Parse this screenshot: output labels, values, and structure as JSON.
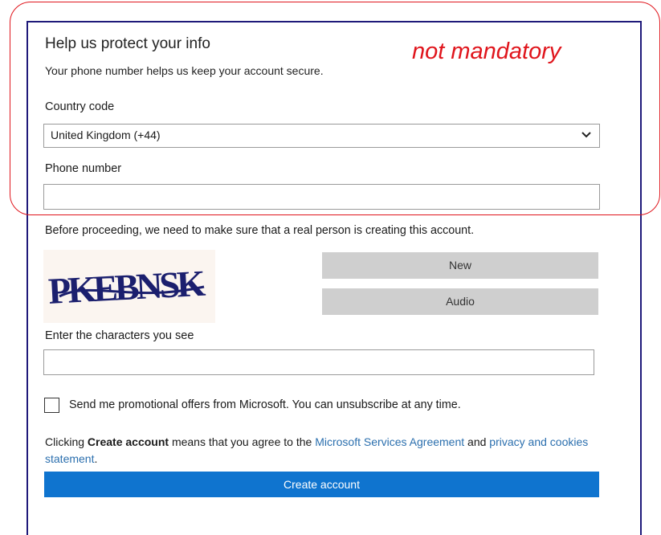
{
  "header": {
    "title": "Help us protect your info",
    "subtitle": "Your phone number helps us keep your account secure."
  },
  "annotation": {
    "text": "not mandatory",
    "color": "#e0151c"
  },
  "country": {
    "label": "Country code",
    "selected": "United Kingdom (+44)"
  },
  "phone": {
    "label": "Phone number",
    "value": ""
  },
  "captcha": {
    "prompt": "Before proceeding, we need to make sure that a real person is creating this account.",
    "image_text": "PKEBNSK",
    "new_label": "New",
    "audio_label": "Audio",
    "input_label": "Enter the characters you see",
    "input_value": ""
  },
  "promo": {
    "label": "Send me promotional offers from Microsoft. You can unsubscribe at any time.",
    "checked": false
  },
  "terms": {
    "prefix": "Clicking ",
    "bold": "Create account",
    "middle": " means that you agree to the ",
    "link1": "Microsoft Services Agreement",
    "and": " and ",
    "link2": "privacy and cookies statement",
    "suffix": "."
  },
  "submit": {
    "label": "Create account"
  },
  "colors": {
    "primary": "#0f74cf",
    "link": "#2b6fae",
    "panel_border": "#1f1a7a"
  }
}
